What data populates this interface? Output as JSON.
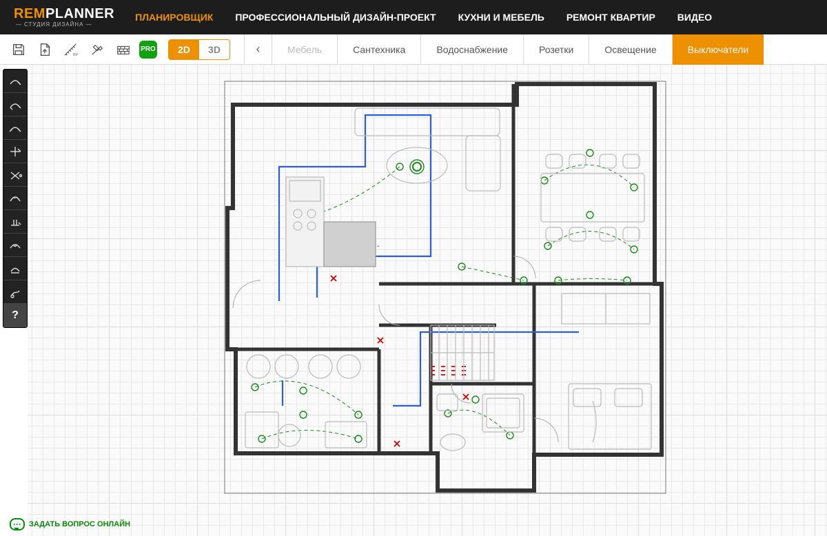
{
  "logo": {
    "rem": "REM",
    "planner": "PLANNER",
    "sub": "СТУДИЯ ДИЗАЙНА"
  },
  "nav": {
    "items": [
      {
        "label": "ПЛАНИРОВЩИК",
        "active": true
      },
      {
        "label": "ПРОФЕССИОНАЛЬНЫЙ ДИЗАЙН-ПРОЕКТ",
        "active": false
      },
      {
        "label": "КУХНИ И МЕБЕЛЬ",
        "active": false
      },
      {
        "label": "РЕМОНТ КВАРТИР",
        "active": false
      },
      {
        "label": "ВИДЕО",
        "active": false
      }
    ]
  },
  "toolbar": {
    "pro": "PRO",
    "views": {
      "v2d": "2D",
      "v3d": "3D"
    },
    "arrow": "‹"
  },
  "tabs": [
    {
      "label": "Мебель",
      "state": "muted"
    },
    {
      "label": "Сантехника",
      "state": ""
    },
    {
      "label": "Водоснабжение",
      "state": ""
    },
    {
      "label": "Розетки",
      "state": ""
    },
    {
      "label": "Освещение",
      "state": ""
    },
    {
      "label": "Выключатели",
      "state": "active"
    }
  ],
  "sidetools_count": 10,
  "help": "?",
  "chat": "ЗАДАТЬ ВОПРОС ОНЛАЙН"
}
